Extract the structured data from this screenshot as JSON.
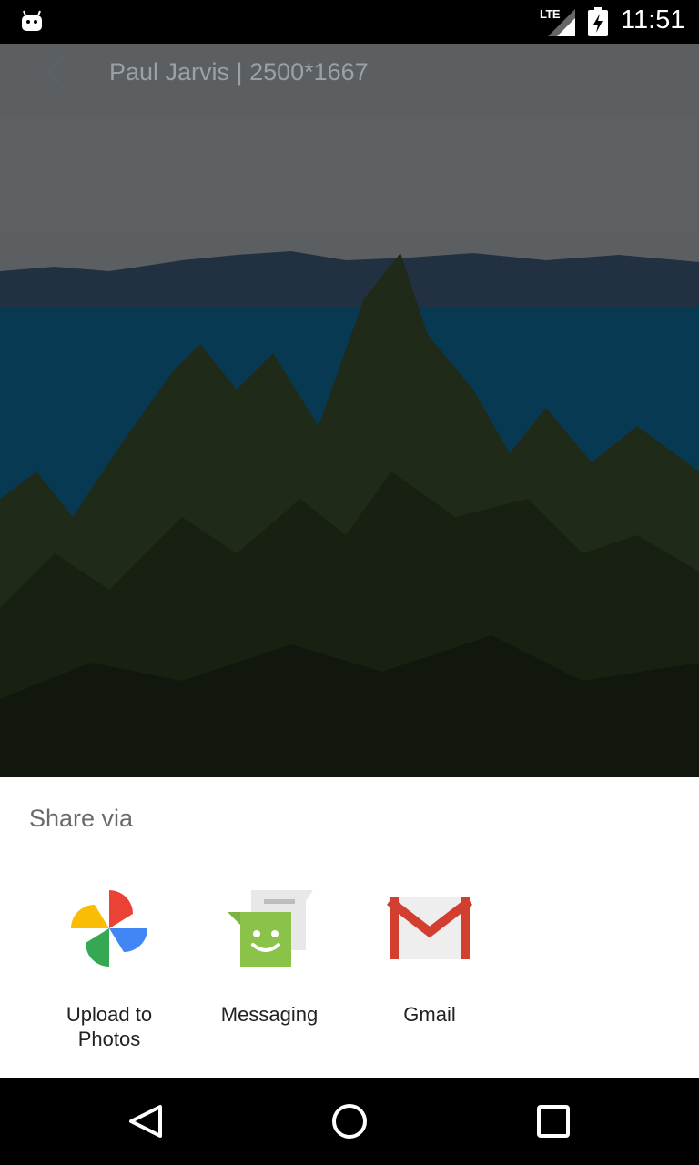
{
  "status_bar": {
    "network": "LTE",
    "time": "11:51"
  },
  "header": {
    "title": "Paul Jarvis | 2500*1667"
  },
  "share_sheet": {
    "title": "Share via",
    "targets": [
      {
        "label": "Upload to\nPhotos",
        "icon": "google-photos-icon"
      },
      {
        "label": "Messaging",
        "icon": "messaging-icon"
      },
      {
        "label": "Gmail",
        "icon": "gmail-icon"
      }
    ]
  },
  "nav_bar": {
    "buttons": [
      "back",
      "home",
      "recents"
    ]
  },
  "colors": {
    "status_bar_bg": "#000000",
    "sheet_bg": "#ffffff",
    "scrim": "rgba(0,0,0,0.45)"
  }
}
